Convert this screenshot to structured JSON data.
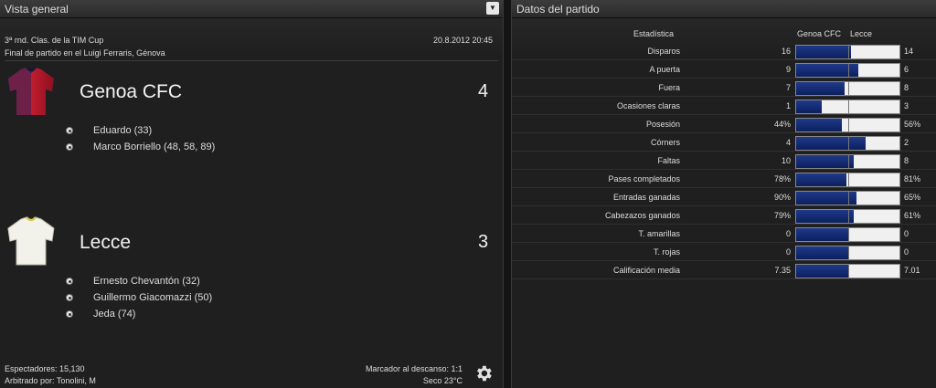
{
  "overview": {
    "title": "Vista general",
    "competition": "3ª rnd. Clas. de la TIM Cup",
    "datetime": "20.8.2012 20:45",
    "venue": "Final de partido en el Luigi Ferraris, Génova",
    "home": {
      "name": "Genoa CFC",
      "score": "4",
      "scorers": [
        "Eduardo (33)",
        "Marco Borriello (48, 58, 89)"
      ]
    },
    "away": {
      "name": "Lecce",
      "score": "3",
      "scorers": [
        "Ernesto Chevantón (32)",
        "Guillermo Giacomazzi (50)",
        "Jeda (74)"
      ]
    },
    "attendance": "Espectadores: 15,130",
    "referee": "Arbitrado por: Tonolini, M",
    "halftime": "Marcador al descanso: 1:1",
    "weather": "Seco 23°C"
  },
  "stats": {
    "title": "Datos del partido",
    "col_stat": "Estadística",
    "col_home": "Genoa CFC",
    "col_away": "Lecce",
    "rows": [
      {
        "label": "Disparos",
        "home": "16",
        "away": "14",
        "fill": 0.53
      },
      {
        "label": "A puerta",
        "home": "9",
        "away": "6",
        "fill": 0.6
      },
      {
        "label": "Fuera",
        "home": "7",
        "away": "8",
        "fill": 0.47
      },
      {
        "label": "Ocasiones claras",
        "home": "1",
        "away": "3",
        "fill": 0.25
      },
      {
        "label": "Posesión",
        "home": "44%",
        "away": "56%",
        "fill": 0.44
      },
      {
        "label": "Córners",
        "home": "4",
        "away": "2",
        "fill": 0.67
      },
      {
        "label": "Faltas",
        "home": "10",
        "away": "8",
        "fill": 0.56
      },
      {
        "label": "Pases completados",
        "home": "78%",
        "away": "81%",
        "fill": 0.49
      },
      {
        "label": "Entradas ganadas",
        "home": "90%",
        "away": "65%",
        "fill": 0.58
      },
      {
        "label": "Cabezazos ganados",
        "home": "79%",
        "away": "61%",
        "fill": 0.56
      },
      {
        "label": "T. amarillas",
        "home": "0",
        "away": "0",
        "fill": 0.5
      },
      {
        "label": "T. rojas",
        "home": "0",
        "away": "0",
        "fill": 0.5
      },
      {
        "label": "Calificación media",
        "home": "7.35",
        "away": "7.01",
        "fill": 0.51
      }
    ]
  },
  "colors": {
    "home_bar": "#0c1f5e",
    "away_bar": "#f0f0f0",
    "home_shirt_red": "#b01828",
    "home_shirt_blue": "#1a2c6a",
    "away_shirt": "#f2f2ea"
  },
  "icons": {
    "collapse": "chevron-down-icon",
    "settings": "gear-icon",
    "goal": "football-icon"
  }
}
